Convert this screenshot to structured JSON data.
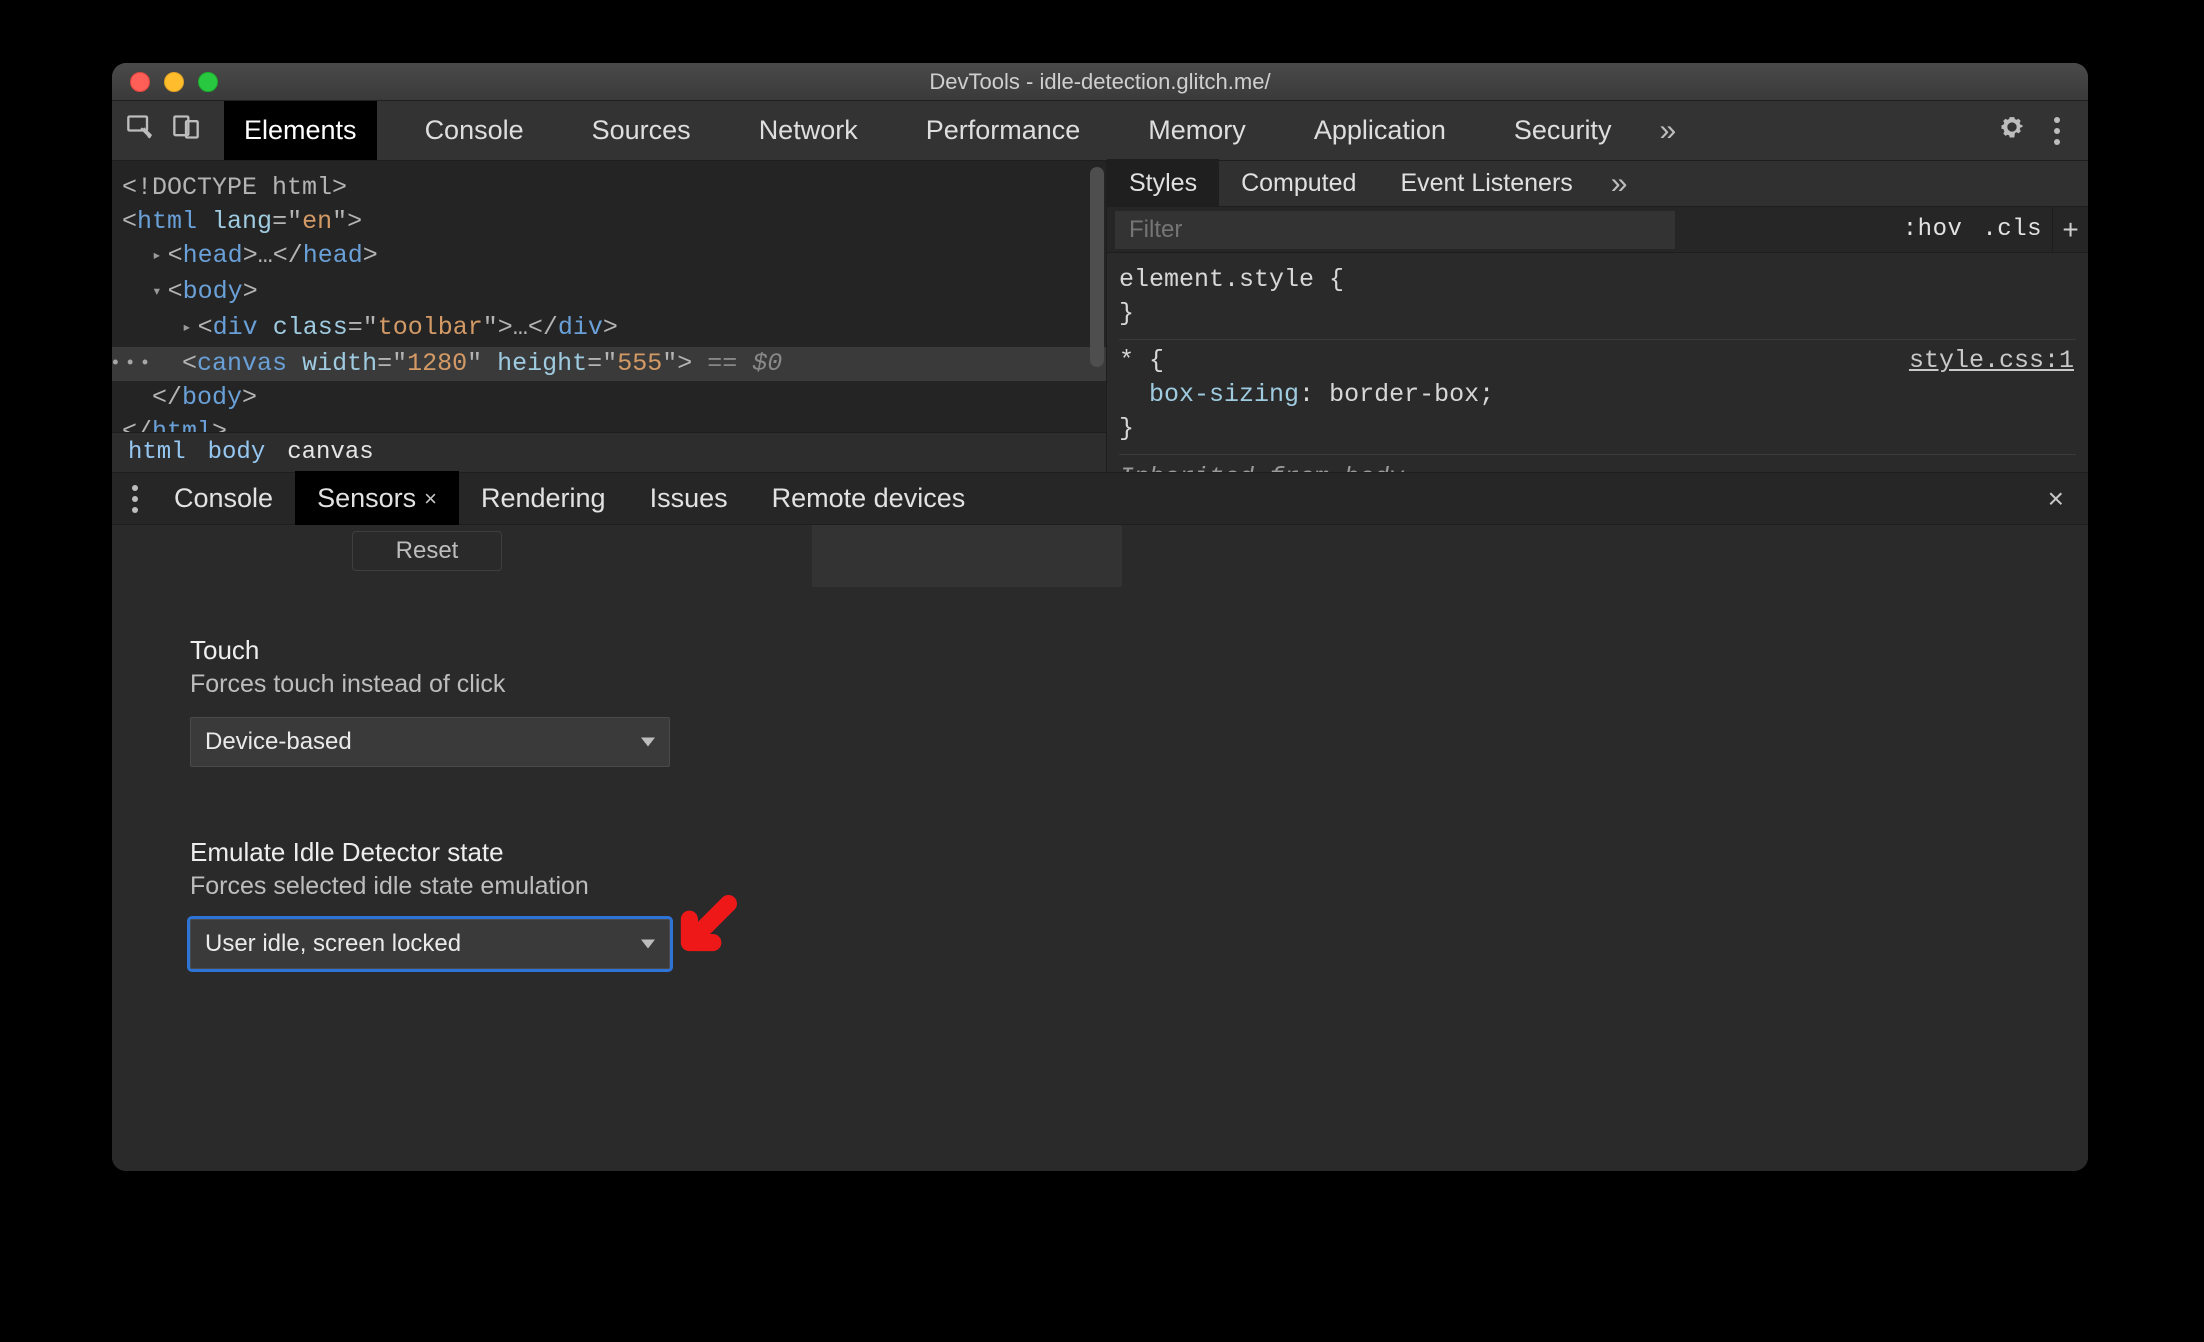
{
  "window": {
    "title": "DevTools - idle-detection.glitch.me/"
  },
  "toolbar": {
    "tabs": [
      "Elements",
      "Console",
      "Sources",
      "Network",
      "Performance",
      "Memory",
      "Application",
      "Security"
    ],
    "active_index": 0,
    "overflow_glyph": "»"
  },
  "dom": {
    "lines": [
      {
        "indent": 0,
        "html": "<!DOCTYPE html>",
        "type": "doctype"
      },
      {
        "indent": 0,
        "html": "<html lang=\"en\">",
        "type": "open",
        "attrs": [
          {
            "n": "lang",
            "v": "en"
          }
        ],
        "arrow": "none",
        "tag": "html"
      },
      {
        "indent": 1,
        "html": "<head>…</head>",
        "type": "collapsed",
        "arrow": "right",
        "tag": "head"
      },
      {
        "indent": 1,
        "html": "<body>",
        "type": "open",
        "arrow": "down",
        "tag": "body"
      },
      {
        "indent": 2,
        "html": "<div class=\"toolbar\">…</div>",
        "type": "collapsed",
        "arrow": "right",
        "tag": "div",
        "attrs": [
          {
            "n": "class",
            "v": "toolbar"
          }
        ]
      },
      {
        "indent": 2,
        "html": "<canvas width=\"1280\" height=\"555\">",
        "type": "selected",
        "tag": "canvas",
        "attrs": [
          {
            "n": "width",
            "v": "1280"
          },
          {
            "n": "height",
            "v": "555"
          }
        ],
        "suffix": " == $0"
      },
      {
        "indent": 1,
        "html": "</body>",
        "type": "close",
        "tag": "body"
      },
      {
        "indent": 0,
        "html": "</html>",
        "type": "close",
        "tag": "html"
      }
    ],
    "breadcrumb": [
      "html",
      "body",
      "canvas"
    ],
    "breadcrumb_active_index": 2
  },
  "styles": {
    "tabs": [
      "Styles",
      "Computed",
      "Event Listeners"
    ],
    "active_index": 0,
    "overflow_glyph": "»",
    "filter_placeholder": "Filter",
    "hov": ":hov",
    "cls": ".cls",
    "plus": "+",
    "rules": [
      {
        "selector": "element.style",
        "decls": [],
        "source": ""
      },
      {
        "selector": "*",
        "decls": [
          {
            "prop": "box-sizing",
            "value": "border-box"
          }
        ],
        "source": "style.css:1"
      }
    ],
    "inherited_label_prefix": "Inherited from ",
    "inherited_from": "body"
  },
  "drawer": {
    "tabs": [
      "Console",
      "Sensors",
      "Rendering",
      "Issues",
      "Remote devices"
    ],
    "active_index": 1,
    "close_glyph": "×",
    "reset_label": "Reset",
    "sections": {
      "touch": {
        "title": "Touch",
        "desc": "Forces touch instead of click",
        "value": "Device-based"
      },
      "idle": {
        "title": "Emulate Idle Detector state",
        "desc": "Forces selected idle state emulation",
        "value": "User idle, screen locked"
      }
    }
  },
  "annotation": {
    "red_arrow_color": "#ef1818"
  }
}
